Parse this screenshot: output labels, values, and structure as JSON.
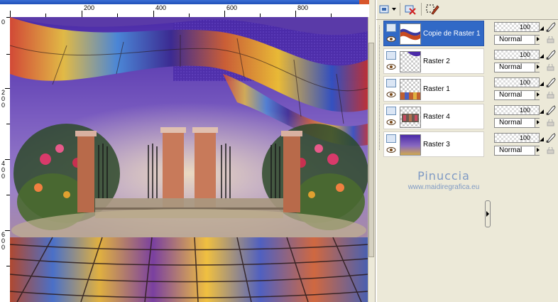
{
  "ruler": {
    "top_labels": [
      "200",
      "400",
      "600",
      "800"
    ],
    "left_labels": [
      {
        "digits": [
          "0"
        ]
      },
      {
        "digits": [
          "2",
          "0",
          "0"
        ]
      },
      {
        "digits": [
          "4",
          "0",
          "0"
        ]
      },
      {
        "digits": [
          "6",
          "0",
          "0"
        ]
      }
    ]
  },
  "toolbar": {
    "icons": [
      "new-layer-icon",
      "dropdown-arrow-icon",
      "delete-layer-icon",
      "edit-selection-icon"
    ]
  },
  "layers": [
    {
      "name": "Copie de Raster 1",
      "selected": true,
      "thumb": "wave"
    },
    {
      "name": "Raster 2",
      "selected": false,
      "thumb": "transparent-corner"
    },
    {
      "name": "Raster 1",
      "selected": false,
      "thumb": "gradient-floor"
    },
    {
      "name": "Raster 4",
      "selected": false,
      "thumb": "garden"
    },
    {
      "name": "Raster 3",
      "selected": false,
      "thumb": "purple-gradient"
    }
  ],
  "properties": [
    {
      "opacity": "100",
      "blend_mode": "Normal"
    },
    {
      "opacity": "100",
      "blend_mode": "Normal"
    },
    {
      "opacity": "100",
      "blend_mode": "Normal"
    },
    {
      "opacity": "100",
      "blend_mode": "Normal"
    },
    {
      "opacity": "100",
      "blend_mode": "Normal"
    }
  ],
  "watermark": {
    "line1": "Pinuccia",
    "line2": "www.maidiregrafica.eu"
  },
  "colors": {
    "selection": "#3169c6",
    "panel_bg": "#ece9d8",
    "watermark": "#7f9ac4"
  }
}
